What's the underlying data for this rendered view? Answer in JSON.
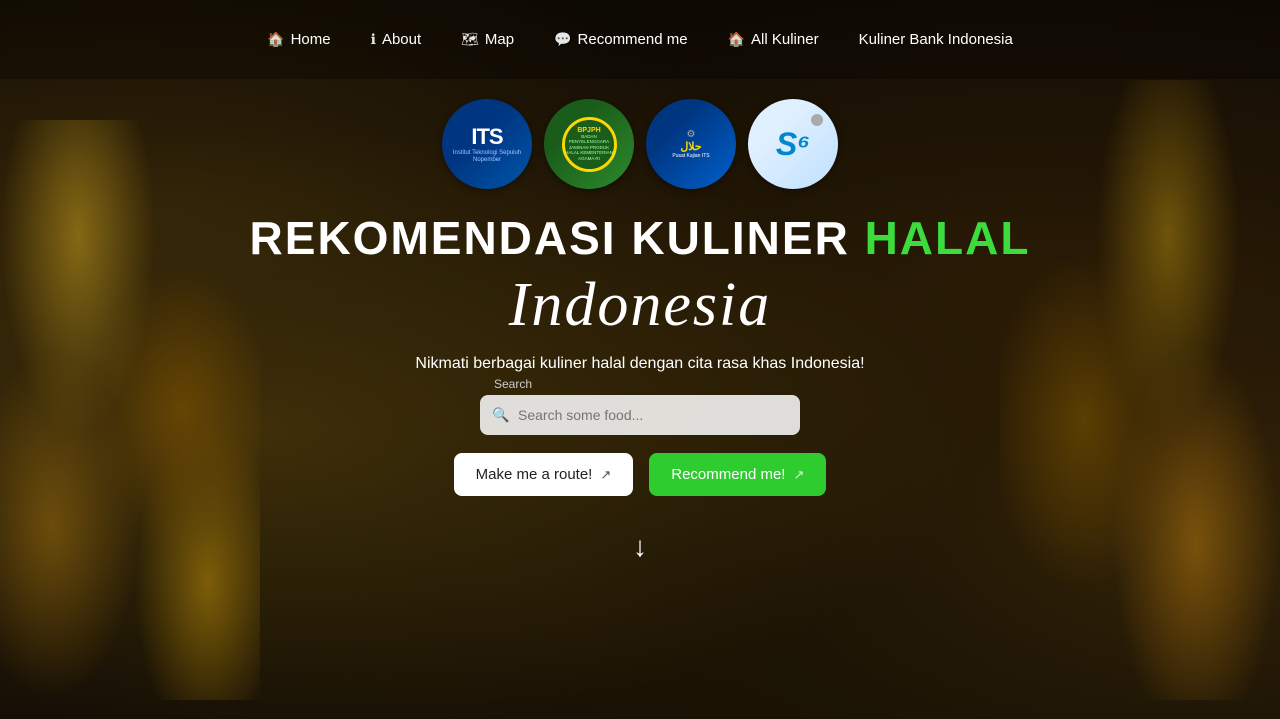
{
  "nav": {
    "items": [
      {
        "id": "home",
        "label": "Home",
        "icon": "🏠"
      },
      {
        "id": "about",
        "label": "About",
        "icon": "ℹ️"
      },
      {
        "id": "map",
        "label": "Map",
        "icon": "🗺"
      },
      {
        "id": "recommend",
        "label": "Recommend me",
        "icon": "💬"
      },
      {
        "id": "allkuliner",
        "label": "All Kuliner",
        "icon": "🏠"
      },
      {
        "id": "kulinerbank",
        "label": "Kuliner Bank Indonesia",
        "icon": ""
      }
    ]
  },
  "logos": [
    {
      "id": "its",
      "alt": "ITS Logo"
    },
    {
      "id": "bpjph",
      "alt": "BPJPH Logo"
    },
    {
      "id": "pusatkajian",
      "alt": "Pusat Kajian Logo"
    },
    {
      "id": "s6",
      "alt": "S6 Logo"
    }
  ],
  "hero": {
    "heading_white": "REKOMENDASI KULINER",
    "heading_green": "HALAL",
    "subheading": "Indonesia",
    "subtitle": "Nikmati berbagai kuliner halal dengan cita rasa khas Indonesia!",
    "search_label": "Search",
    "search_placeholder": "Search some food...",
    "btn_route_label": "Make me a route!",
    "btn_recommend_label": "Recommend me!",
    "external_icon": "↗"
  }
}
